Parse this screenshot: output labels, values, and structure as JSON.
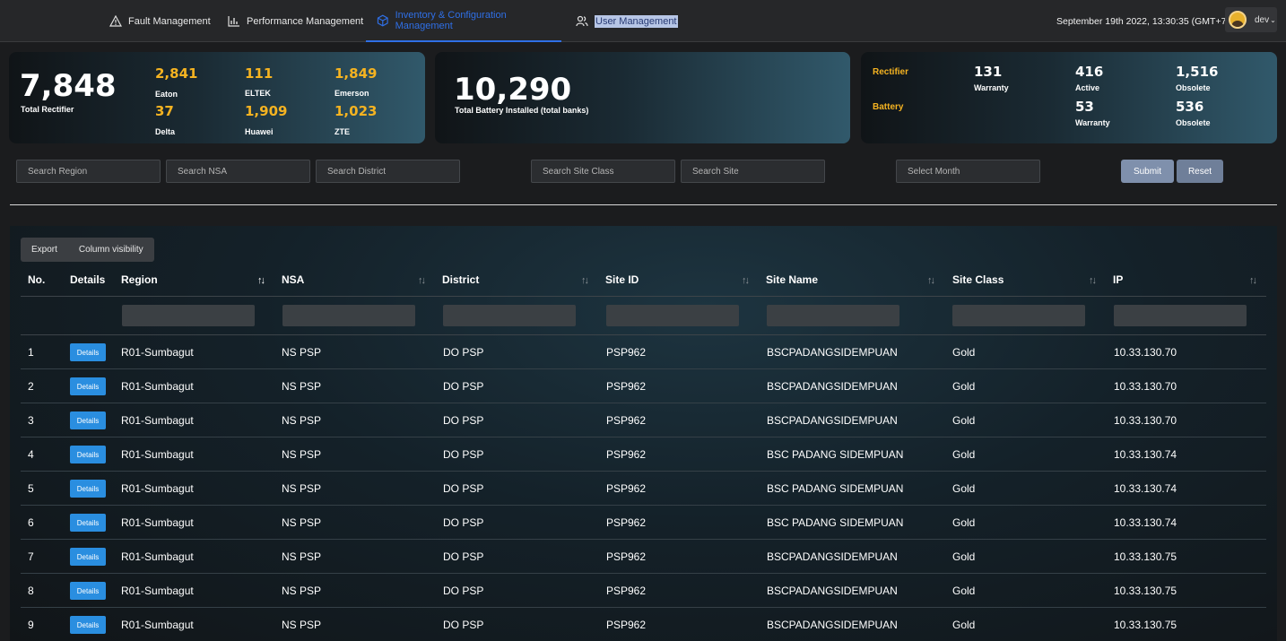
{
  "nav": {
    "items": [
      {
        "label": "Fault Management",
        "icon": "warning-icon"
      },
      {
        "label": "Performance Management",
        "icon": "chart-icon"
      },
      {
        "label": "Inventory & Configuration Management",
        "icon": "cube-icon"
      },
      {
        "label": "User Management",
        "icon": "users-icon"
      }
    ],
    "active_index": 2,
    "datetime": "September 19th 2022, 13:30:35 (GMT+7)",
    "user": "dev"
  },
  "rectifier_card": {
    "total": "7,848",
    "total_label": "Total Rectifier",
    "vendors": [
      {
        "value": "2,841",
        "name": "Eaton"
      },
      {
        "value": "111",
        "name": "ELTEK"
      },
      {
        "value": "1,849",
        "name": "Emerson"
      },
      {
        "value": "37",
        "name": "Delta"
      },
      {
        "value": "1,909",
        "name": "Huawei"
      },
      {
        "value": "1,023",
        "name": "ZTE"
      }
    ]
  },
  "battery_card": {
    "total": "10,290",
    "total_label": "Total Battery Installed (total banks)"
  },
  "status_card": {
    "rectifier_label": "Rectifier",
    "battery_label": "Battery",
    "rectifier": [
      {
        "value": "131",
        "name": "Warranty"
      },
      {
        "value": "416",
        "name": "Active"
      },
      {
        "value": "1,516",
        "name": "Obsolete"
      }
    ],
    "battery": [
      {
        "value": "53",
        "name": "Warranty"
      },
      {
        "value": "536",
        "name": "Obsolete"
      }
    ]
  },
  "filters": {
    "region": "Search Region",
    "nsa": "Search NSA",
    "district": "Search District",
    "site_class": "Search Site Class",
    "site": "Search Site",
    "month": "Select Month",
    "submit": "Submit",
    "reset": "Reset"
  },
  "toolbar": {
    "export": "Export",
    "column_visibility": "Column visibility"
  },
  "table": {
    "columns": [
      "No.",
      "Details",
      "Region",
      "NSA",
      "District",
      "Site ID",
      "Site Name",
      "Site Class",
      "IP"
    ],
    "details_label": "Details",
    "sort_glyph": "↑↓",
    "rows": [
      [
        "1",
        "R01-Sumbagut",
        "NS PSP",
        "DO PSP",
        "PSP962",
        "BSCPADANGSIDEMPUAN",
        "Gold",
        "10.33.130.70"
      ],
      [
        "2",
        "R01-Sumbagut",
        "NS PSP",
        "DO PSP",
        "PSP962",
        "BSCPADANGSIDEMPUAN",
        "Gold",
        "10.33.130.70"
      ],
      [
        "3",
        "R01-Sumbagut",
        "NS PSP",
        "DO PSP",
        "PSP962",
        "BSCPADANGSIDEMPUAN",
        "Gold",
        "10.33.130.70"
      ],
      [
        "4",
        "R01-Sumbagut",
        "NS PSP",
        "DO PSP",
        "PSP962",
        "BSC PADANG SIDEMPUAN",
        "Gold",
        "10.33.130.74"
      ],
      [
        "5",
        "R01-Sumbagut",
        "NS PSP",
        "DO PSP",
        "PSP962",
        "BSC PADANG SIDEMPUAN",
        "Gold",
        "10.33.130.74"
      ],
      [
        "6",
        "R01-Sumbagut",
        "NS PSP",
        "DO PSP",
        "PSP962",
        "BSC PADANG SIDEMPUAN",
        "Gold",
        "10.33.130.74"
      ],
      [
        "7",
        "R01-Sumbagut",
        "NS PSP",
        "DO PSP",
        "PSP962",
        "BSCPADANGSIDEMPUAN",
        "Gold",
        "10.33.130.75"
      ],
      [
        "8",
        "R01-Sumbagut",
        "NS PSP",
        "DO PSP",
        "PSP962",
        "BSCPADANGSIDEMPUAN",
        "Gold",
        "10.33.130.75"
      ],
      [
        "9",
        "R01-Sumbagut",
        "NS PSP",
        "DO PSP",
        "PSP962",
        "BSCPADANGSIDEMPUAN",
        "Gold",
        "10.33.130.75"
      ]
    ]
  },
  "colors": {
    "accent_blue": "#2f6fe6",
    "details_button": "#2a8ee0",
    "yellow": "#f5b321",
    "submit_button": "#7f90ac"
  }
}
